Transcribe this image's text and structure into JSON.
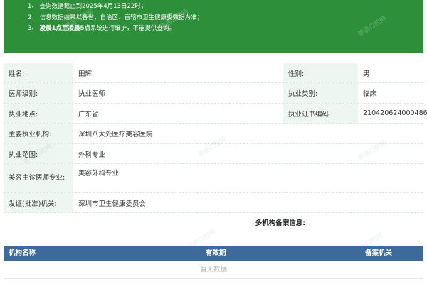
{
  "notice": {
    "line1": "1、 查询数据截止到2025年4月13日22时；",
    "line2": "2、 信息数据结果以各省、自治区、直辖市卫生健康委数据为准；",
    "line3_prefix": "3、 ",
    "line3_bold": "凌晨1点至凌晨5点",
    "line3_suffix": "系统进行维护，不能提供查询。"
  },
  "watermark": "德语口腔网",
  "doctor": {
    "name_label": "姓名:",
    "name": "田辉",
    "gender_label": "性别:",
    "gender": "男",
    "level_label": "医师级别:",
    "level": "执业医师",
    "category_label": "执业类别:",
    "category": "临床",
    "location_label": "执业地点:",
    "location": "广东省",
    "cert_label": "执业证书编码:",
    "cert": "210420624000486",
    "institution_label": "主要执业机构:",
    "institution": "深圳八大处医疗美容医院",
    "scope_label": "执业范围:",
    "scope": "外科专业",
    "cosmetic_label": "美容主诊医师专业:",
    "cosmetic": "美容外科专业",
    "issuer_label": "发证(批准)机关:",
    "issuer": "深圳市卫生健康委员会"
  },
  "multi": {
    "title": "多机构备案信息:",
    "col_name": "机构名称",
    "col_valid": "有效期",
    "col_org": "备案机关",
    "empty": "暂无数据"
  }
}
